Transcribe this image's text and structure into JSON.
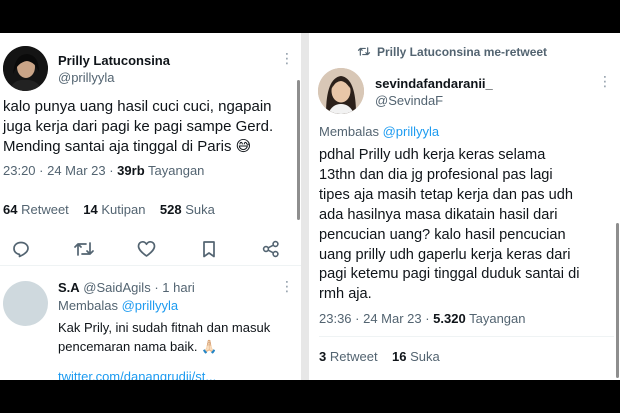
{
  "left_tweet": {
    "author_name": "Prilly Latuconsina",
    "author_handle": "@prillyyla",
    "text": "kalo punya uang hasil cuci cuci, ngapain\njuga kerja dari pagi ke pagi sampe Gerd.\nMending santai aja tinggal di Paris 😅",
    "time": "23:20 · 24 Mar 23 · ",
    "views_count": "39rb",
    "views_label": "Tayangan",
    "retweets_count": "64",
    "retweets_label": "Retweet",
    "quotes_count": "14",
    "quotes_label": "Kutipan",
    "likes_count": "528",
    "likes_label": "Suka"
  },
  "reply": {
    "author_name": "S.A",
    "author_handle": "@SaidAgils",
    "time": "· 1 hari",
    "replying_prefix": "Membalas",
    "replying_to": "@prillyyla",
    "text": "Kak Prily, ini sudah fitnah dan masuk\npencemaran nama baik. 🙏🏻",
    "link": "twitter.com/danangrudii/st..."
  },
  "right_tweet": {
    "retweeted_by": "Prilly Latuconsina me-retweet",
    "author_name": "sevindafandaranii_",
    "author_handle": "@SevindaF",
    "replying_prefix": "Membalas",
    "replying_to": "@prillyyla",
    "text": "pdhal Prilly udh kerja keras selama\n13thn dan dia jg profesional pas lagi\ntipes aja masih tetap kerja dan pas udh\nada hasilnya masa dikatain hasil dari\npencucian uang? kalo hasil pencucian\nuang prilly udh gaperlu kerja keras dari\npagi ketemu pagi tinggal duduk santai di\nrmh aja.",
    "time": "23:36 · 24 Mar 23 · ",
    "views_count": "5.320",
    "views_label": "Tayangan",
    "retweets_count": "3",
    "retweets_label": "Retweet",
    "likes_count": "16",
    "likes_label": "Suka"
  },
  "colors": {
    "accent": "#1d9bf0",
    "muted": "#536471",
    "text": "#0f1419"
  },
  "icons": [
    "more-icon",
    "reply-icon",
    "retweet-icon",
    "like-icon",
    "bookmark-icon",
    "share-icon",
    "retweet-small-icon"
  ]
}
